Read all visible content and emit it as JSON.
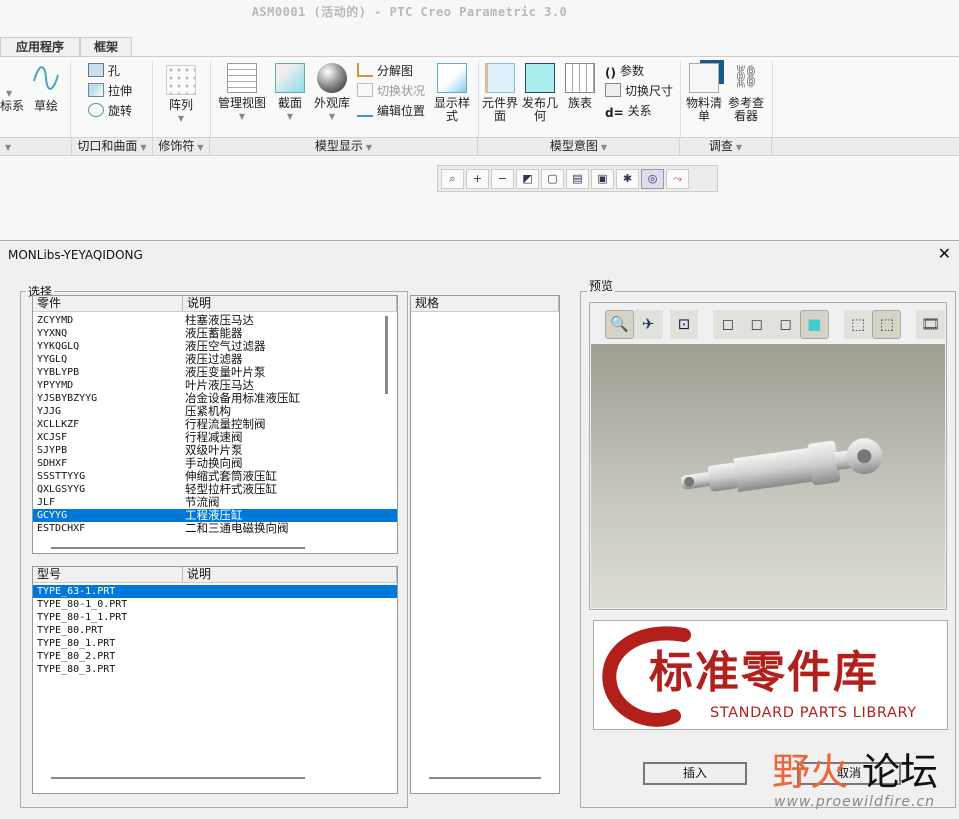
{
  "window": {
    "title": "ASM0001 (活动的) - PTC Creo Parametric 3.0"
  },
  "tabs": [
    "应用程序",
    "框架"
  ],
  "ribbon": {
    "coord_partial": "标系",
    "sketch": "草绘",
    "hole": "孔",
    "extrude": "拉伸",
    "revolve": "旋转",
    "pattern": "阵列",
    "manage_views": "管理视图",
    "section": "截面",
    "appearance": "外观库",
    "explode": "分解图",
    "toggle_state": "切换状况",
    "edit_position": "编辑位置",
    "display_style": "显示样式",
    "component_interface": "元件界面",
    "publish_geometry": "发布几何",
    "family_table": "族表",
    "parameters": "参数",
    "switch_dimensions": "切换尺寸",
    "relations": "关系",
    "bom": "物料清单",
    "reference_viewer": "参考查看器",
    "groups": [
      "切口和曲面",
      "修饰符",
      "模型显示",
      "模型意图",
      "调查"
    ]
  },
  "dialog": {
    "title": "MONLibs-YEYAQIDONG",
    "select_label": "选择",
    "parts_header": [
      "零件",
      "说明"
    ],
    "parts": [
      [
        "ZCYYMD",
        "柱塞液压马达"
      ],
      [
        "YYXNQ",
        "液压蓄能器"
      ],
      [
        "YYKQGLQ",
        "液压空气过滤器"
      ],
      [
        "YYGLQ",
        "液压过滤器"
      ],
      [
        "YYBLYPB",
        "液压变量叶片泵"
      ],
      [
        "YPYYMD",
        "叶片液压马达"
      ],
      [
        "YJSBYBZYYG",
        "冶金设备用标准液压缸"
      ],
      [
        "YJJG",
        "压紧机构"
      ],
      [
        "XCLLKZF",
        "行程流量控制阀"
      ],
      [
        "XCJSF",
        "行程减速阀"
      ],
      [
        "SJYPB",
        "双级叶片泵"
      ],
      [
        "SDHXF",
        "手动换向阀"
      ],
      [
        "SSSTTYYG",
        "伸缩式套筒液压缸"
      ],
      [
        "QXLGSYYG",
        "轻型拉杆式液压缸"
      ],
      [
        "JLF",
        "节流阀"
      ],
      [
        "GCYYG",
        "工程液压缸"
      ],
      [
        "ESTDCHXF",
        "二和三通电磁换向阀"
      ]
    ],
    "parts_selected": 15,
    "types_header": [
      "型号",
      "说明"
    ],
    "types": [
      "TYPE_63-1.PRT",
      "TYPE_80-1_0.PRT",
      "TYPE_80-1_1.PRT",
      "TYPE_80.PRT",
      "TYPE_80_1.PRT",
      "TYPE_80_2.PRT",
      "TYPE_80_3.PRT"
    ],
    "types_selected": 0,
    "spec_header": "规格",
    "preview_label": "预览",
    "logo_cn": "标准零件库",
    "logo_en": "STANDARD PARTS LIBRARY",
    "insert": "插入",
    "cancel": "取消",
    "watermark": {
      "cn1": "野火",
      "cn2": "论坛",
      "url": "www.proewildfire.cn"
    }
  },
  "colors": {
    "selection": "#0078d7",
    "logo_red": "#b3201c"
  }
}
